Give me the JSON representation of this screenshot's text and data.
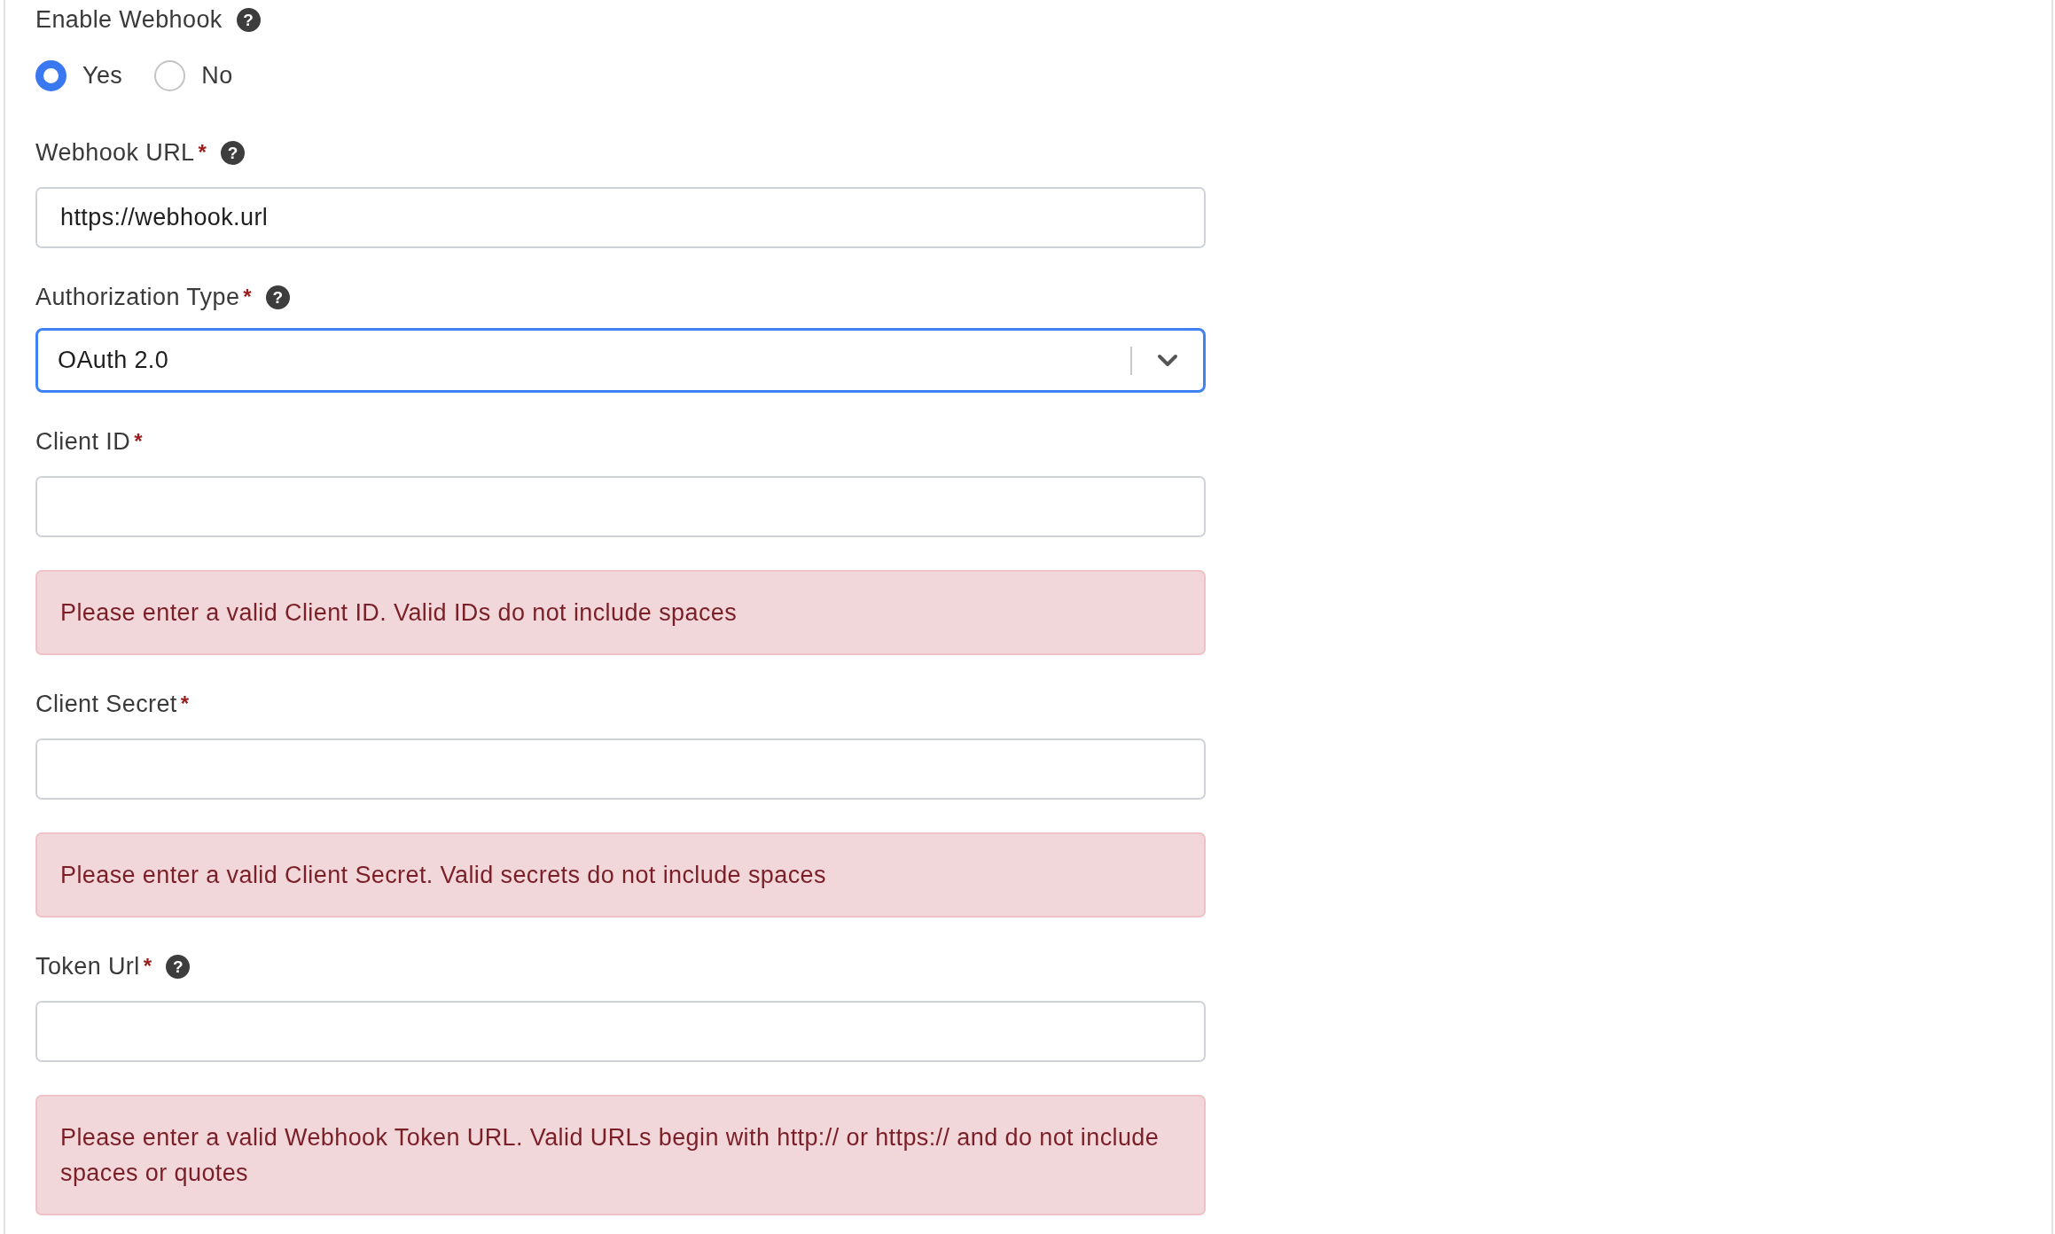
{
  "enable_webhook": {
    "label": "Enable Webhook",
    "help_icon": "?",
    "options": [
      {
        "label": "Yes",
        "selected": true
      },
      {
        "label": "No",
        "selected": false
      }
    ]
  },
  "fields": [
    {
      "kind": "text",
      "label": "Webhook URL",
      "required_mark": "*",
      "help_icon": "?",
      "value": "https://webhook.url"
    },
    {
      "kind": "select",
      "label": "Authorization Type",
      "required_mark": "*",
      "help_icon": "?",
      "value": "OAuth 2.0",
      "focused": true
    },
    {
      "kind": "text",
      "label": "Client ID",
      "required_mark": "*",
      "error": "Please enter a valid Client ID. Valid IDs do not include spaces"
    },
    {
      "kind": "text",
      "label": "Client Secret",
      "required_mark": "*",
      "error": "Please enter a valid Client Secret. Valid secrets do not include spaces"
    },
    {
      "kind": "text",
      "label": "Token Url",
      "required_mark": "*",
      "help_icon": "?",
      "error": "Please enter a valid Webhook Token URL. Valid URLs begin with http:// or https:// and do not include spaces or quotes"
    }
  ]
}
